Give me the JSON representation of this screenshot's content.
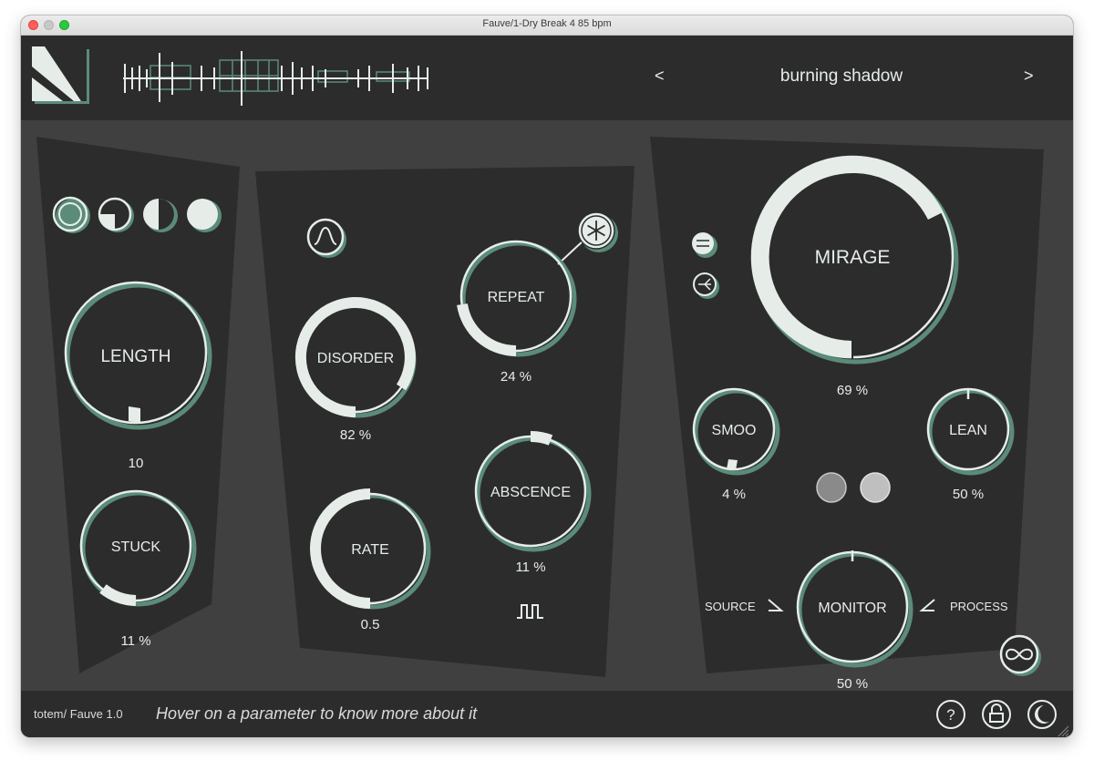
{
  "window": {
    "title": "Fauve/1-Dry Break 4 85 bpm"
  },
  "header": {
    "preset_name": "burning shadow",
    "prev_label": "<",
    "next_label": ">"
  },
  "colors": {
    "accent": "#d9e6e0",
    "panel": "#2c2c2c",
    "background": "#404040",
    "shadow": "#5b8b79"
  },
  "left_panel": {
    "length": {
      "label": "LENGTH",
      "value": "10"
    },
    "stuck": {
      "label": "STUCK",
      "value": "11 %"
    }
  },
  "mid_panel": {
    "disorder": {
      "label": "DISORDER",
      "value": "82 %"
    },
    "rate": {
      "label": "RATE",
      "value": "0.5"
    },
    "repeat": {
      "label": "REPEAT",
      "value": "24 %"
    },
    "absence": {
      "label": "ABSCENCE",
      "value": "11 %"
    }
  },
  "right_panel": {
    "mirage": {
      "label": "MIRAGE",
      "value": "69 %"
    },
    "smoo": {
      "label": "SMOO",
      "value": "4 %"
    },
    "lean": {
      "label": "LEAN",
      "value": "50 %"
    },
    "monitor": {
      "label": "MONITOR",
      "value": "50 %"
    },
    "source_label": "SOURCE",
    "process_label": "PROCESS"
  },
  "footer": {
    "version": "totem/ Fauve 1.0",
    "hint": "Hover on a parameter to know more about it"
  },
  "icons": [
    "logo-icon",
    "waveform-icon",
    "shape-icon",
    "freeze-icon",
    "square-wave-icon",
    "infinity-icon",
    "help-icon",
    "lock-icon",
    "moon-icon"
  ]
}
